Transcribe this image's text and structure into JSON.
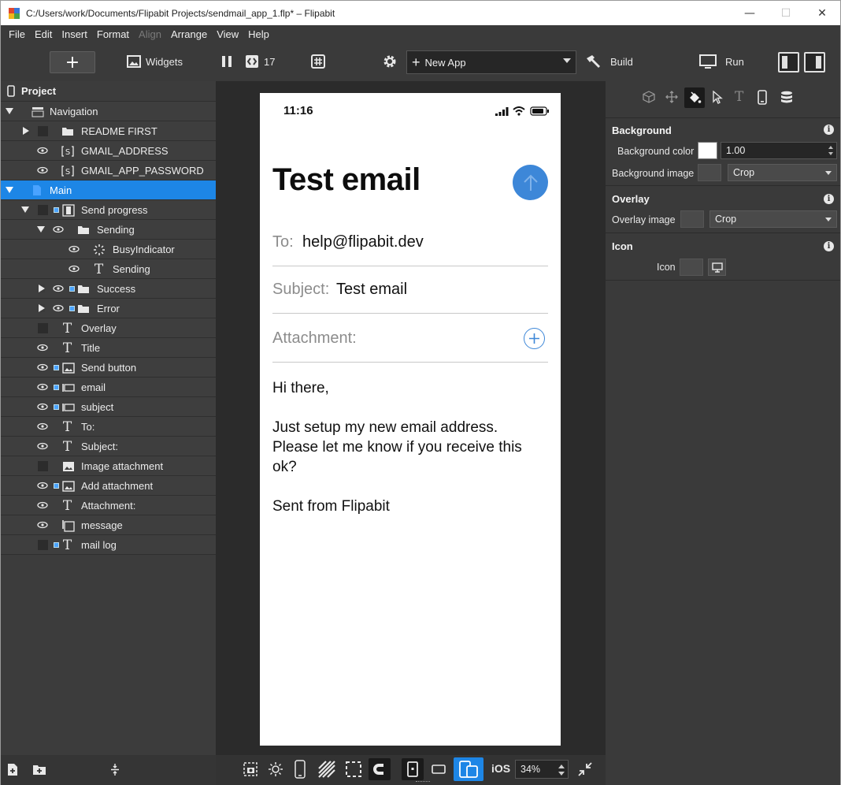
{
  "window": {
    "title": "C:/Users/work/Documents/Flipabit Projects/sendmail_app_1.flp* – Flipabit",
    "minimize": "—",
    "maximize": "☐",
    "close": "✕"
  },
  "menu": {
    "items": [
      "File",
      "Edit",
      "Insert",
      "Format",
      "Align",
      "Arrange",
      "View",
      "Help"
    ]
  },
  "toolbar": {
    "add_label": "+",
    "widgets_label": "Widgets",
    "pages_count": "17",
    "app_selector": "New App",
    "build_label": "Build",
    "run_label": "Run"
  },
  "tree": {
    "header": "Project",
    "rows": [
      {
        "label": "Navigation"
      },
      {
        "label": "README FIRST"
      },
      {
        "label": "GMAIL_ADDRESS"
      },
      {
        "label": "GMAIL_APP_PASSWORD"
      },
      {
        "label": "Main"
      },
      {
        "label": "Send progress"
      },
      {
        "label": "Sending"
      },
      {
        "label": "BusyIndicator"
      },
      {
        "label": "Sending"
      },
      {
        "label": "Success"
      },
      {
        "label": "Error"
      },
      {
        "label": "Overlay"
      },
      {
        "label": "Title"
      },
      {
        "label": "Send button"
      },
      {
        "label": "email"
      },
      {
        "label": "subject"
      },
      {
        "label": "To:"
      },
      {
        "label": "Subject:"
      },
      {
        "label": "Image attachment"
      },
      {
        "label": "Add attachment"
      },
      {
        "label": "Attachment:"
      },
      {
        "label": "message"
      },
      {
        "label": "mail log"
      }
    ]
  },
  "phone": {
    "time": "11:16",
    "title": "Test email",
    "to_label": "To:",
    "to_value": "help@flipabit.dev",
    "subject_label": "Subject:",
    "subject_value": "Test email",
    "attachment_label": "Attachment:",
    "body_line1": "Hi there,",
    "body_line2": "Just setup my new email address.",
    "body_line3": "Please let me know if you receive this",
    "body_line4": "ok?",
    "body_line5": "Sent from Flipabit",
    "accent": "#3d87d8"
  },
  "bottom_bar": {
    "platform": "iOS",
    "zoom": "34%"
  },
  "properties": {
    "background": {
      "header": "Background",
      "color_label": "Background color",
      "opacity": "1.00",
      "image_label": "Background image",
      "image_mode": "Crop"
    },
    "overlay": {
      "header": "Overlay",
      "image_label": "Overlay image",
      "image_mode": "Crop"
    },
    "icon": {
      "header": "Icon",
      "label": "Icon"
    }
  },
  "colors": {
    "selection": "#1d86e6",
    "panel": "#3a3a3a",
    "canvas": "#2b2b2b"
  }
}
